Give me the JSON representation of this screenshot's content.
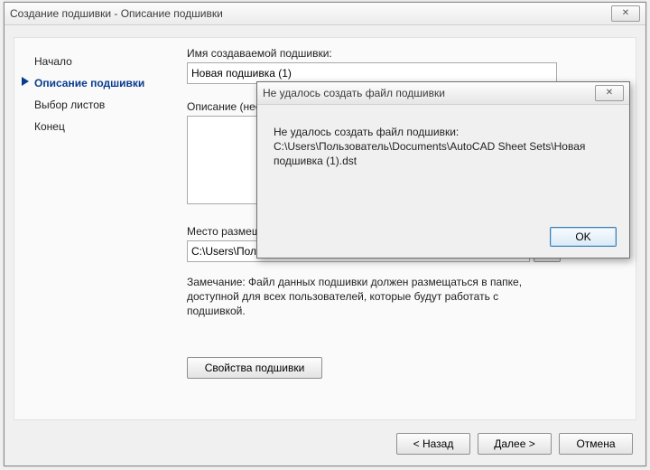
{
  "wizard": {
    "title": "Создание подшивки - Описание подшивки",
    "steps": [
      {
        "label": "Начало",
        "active": false
      },
      {
        "label": "Описание подшивки",
        "active": true
      },
      {
        "label": "Выбор листов",
        "active": false
      },
      {
        "label": "Конец",
        "active": false
      }
    ],
    "name_label": "Имя создаваемой подшивки:",
    "name_value": "Новая подшивка (1)",
    "desc_label": "Описание (необязательно):",
    "desc_value": "",
    "path_label": "Место размещения файла данных подшивки (.dst):",
    "path_value": "C:\\Users\\Пользователь\\Documents\\AutoCAD Sheet Sets",
    "browse_label": "...",
    "note": "Замечание: Файл данных подшивки должен размещаться в папке, доступной для всех пользователей, которые будут работать с подшивкой.",
    "props_btn": "Свойства подшивки",
    "back_btn": "< Назад",
    "next_btn": "Далее >",
    "cancel_btn": "Отмена"
  },
  "popup": {
    "title": "Не удалось создать файл подшивки",
    "line1": "Не удалось создать файл подшивки:",
    "line2": "C:\\Users\\Пользователь\\Documents\\AutoCAD Sheet Sets\\Новая подшивка (1).dst",
    "ok": "OK"
  }
}
